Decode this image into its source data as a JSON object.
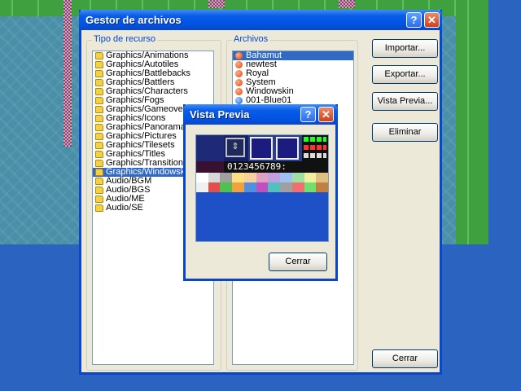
{
  "main_window": {
    "title": "Gestor de archivos",
    "help_label": "?",
    "close_label": "✕",
    "resource_group_label": "Tipo de recurso",
    "files_group_label": "Archivos",
    "resource_types": [
      "Graphics/Animations",
      "Graphics/Autotiles",
      "Graphics/Battlebacks",
      "Graphics/Battlers",
      "Graphics/Characters",
      "Graphics/Fogs",
      "Graphics/Gameovers",
      "Graphics/Icons",
      "Graphics/Panoramas",
      "Graphics/Pictures",
      "Graphics/Tilesets",
      "Graphics/Titles",
      "Graphics/Transitions",
      "Graphics/Windowskins",
      "Audio/BGM",
      "Audio/BGS",
      "Audio/ME",
      "Audio/SE"
    ],
    "selected_resource_index": 13,
    "files": [
      "Bahamut",
      "newtest",
      "Royal",
      "System",
      "Windowskin",
      "001-Blue01"
    ],
    "selected_file_index": 0,
    "buttons": {
      "import": "Importar...",
      "export": "Exportar...",
      "preview": "Vista Previa...",
      "delete": "Eliminar",
      "close": "Cerrar"
    }
  },
  "preview_window": {
    "title": "Vista Previa",
    "help_label": "?",
    "close_label": "✕",
    "digits_text": "0123456789:",
    "close_button": "Cerrar",
    "colors": {
      "row1": [
        "#ffffff",
        "#d8d8d8",
        "#a0a0a0",
        "#ffe080",
        "#f8d0a0",
        "#e0a0c0",
        "#c0a0e0",
        "#a0c0f0",
        "#a0e0a0",
        "#f0f0a0",
        "#e0c080"
      ],
      "row2": [
        "#f0f0f0",
        "#e05050",
        "#50c050",
        "#f0a040",
        "#5090e0",
        "#c050c0",
        "#50c0c0",
        "#a0a0a0",
        "#f07070",
        "#70e070",
        "#c08040"
      ]
    }
  }
}
